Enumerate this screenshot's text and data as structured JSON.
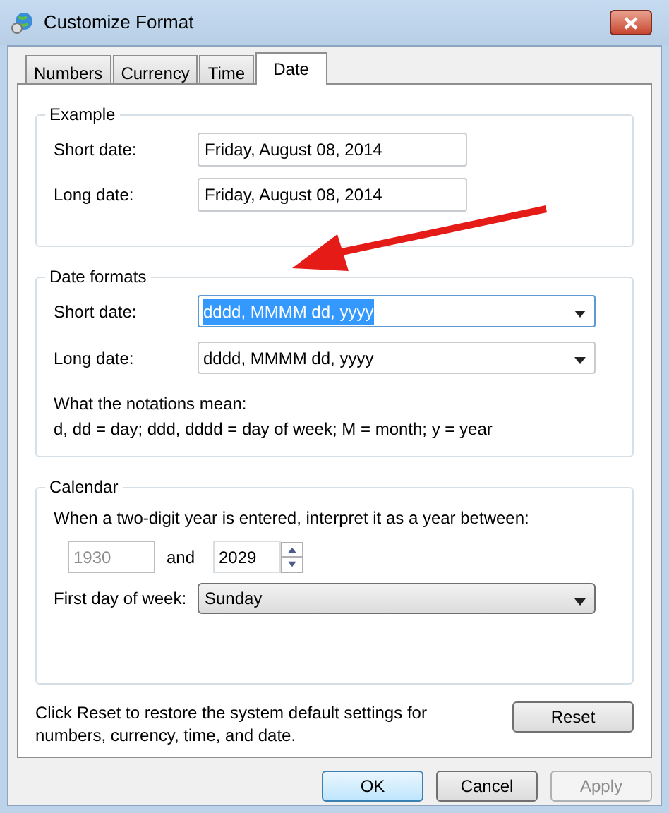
{
  "window": {
    "title": "Customize Format"
  },
  "tabs": [
    {
      "label": "Numbers",
      "selected": false
    },
    {
      "label": "Currency",
      "selected": false
    },
    {
      "label": "Time",
      "selected": false
    },
    {
      "label": "Date",
      "selected": true
    }
  ],
  "example": {
    "title": "Example",
    "fields": [
      {
        "label": "Short date:",
        "value": "Friday, August 08, 2014"
      },
      {
        "label": "Long date:",
        "value": "Friday, August 08, 2014"
      }
    ]
  },
  "date_formats": {
    "title": "Date formats",
    "fields": [
      {
        "label": "Short date:",
        "value": "dddd, MMMM dd, yyyy",
        "selected": true
      },
      {
        "label": "Long date:",
        "value": "dddd, MMMM dd, yyyy",
        "selected": false
      }
    ],
    "notes_title": "What the notations mean:",
    "notes": "d, dd = day;  ddd, dddd = day of week;  M = month;  y = year"
  },
  "calendar": {
    "title": "Calendar",
    "two_digit_label": "When a two-digit year is entered, interpret it as a year between:",
    "year_from": {
      "value": "1930",
      "disabled": true
    },
    "and_label": "and",
    "year_to": {
      "value": "2029",
      "disabled": false
    },
    "first_day_label": "First day of week:",
    "first_day": "Sunday"
  },
  "reset_note": "Click Reset to restore the system default settings for numbers, currency, time, and date.",
  "reset_button": "Reset",
  "buttons": [
    {
      "label": "OK",
      "default": true,
      "disabled": false
    },
    {
      "label": "Cancel",
      "default": false,
      "disabled": false
    },
    {
      "label": "Apply",
      "default": false,
      "disabled": true
    }
  ],
  "annotation_arrow": true
}
